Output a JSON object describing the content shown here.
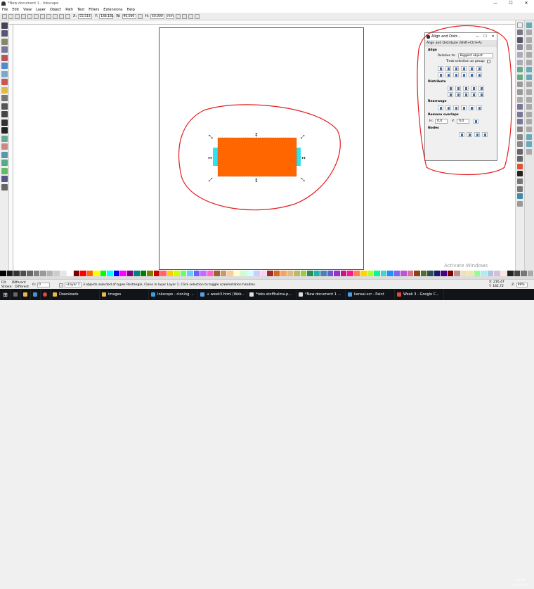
{
  "window": {
    "title": "*New document 1 - Inkscape",
    "controls": [
      "—",
      "☐",
      "✕"
    ]
  },
  "menu": [
    "File",
    "Edit",
    "View",
    "Layer",
    "Object",
    "Path",
    "Text",
    "Filters",
    "Extensions",
    "Help"
  ],
  "controls_bar": {
    "x_label": "X:",
    "x_value": "55,514",
    "y_label": "Y:",
    "y_value": "148,181",
    "w_label": "W:",
    "w_value": "90,000",
    "h_label": "H:",
    "h_value": "40,000",
    "unit": "mm"
  },
  "dialog": {
    "title": "Align and Distr...",
    "header": "Align and Distribute (Shift+Ctrl+A)",
    "controls": [
      "—",
      "☐",
      "✕"
    ],
    "align_label": "Align",
    "relative_label": "Relative to:",
    "relative_value": "Biggest object",
    "treat_label": "Treat selection as group:",
    "distribute_label": "Distribute",
    "rearrange_label": "Rearrange",
    "overlap_label": "Remove overlaps",
    "h_label": "H:",
    "h_value": "0,0",
    "v_label": "V:",
    "v_value": "0,0",
    "nodes_label": "Nodes"
  },
  "status": {
    "fill_label": "Fill:",
    "fill_value": "Different",
    "stroke_label": "Stroke:",
    "stroke_value": "Different",
    "o_label": "O:",
    "o_value": "0",
    "layer_value": "•Layer 1",
    "message": "3 objects selected of types Rectangle, Clone in layer Layer 1. Click selection to toggle scale/rotation handles.",
    "x_coord_label": "X:",
    "x_coord": "216,47",
    "y_coord_label": "Y:",
    "y_coord": "182,72",
    "z_label": "Z:",
    "zoom": "99%"
  },
  "watermark": "Activate Windows",
  "taskbar": {
    "items": [
      {
        "label": "Downloads",
        "color": "#e8b84a"
      },
      {
        "label": "images",
        "color": "#e8b84a"
      },
      {
        "label": "Inkscape - cloning ...",
        "color": "#3aa0e0"
      },
      {
        "label": "+ week3.html (Web...",
        "color": "#5aa0e0"
      },
      {
        "label": "*toks-stoffhalma.p...",
        "color": "#dddddd"
      },
      {
        "label": "*New document 1 ...",
        "color": "#dddddd"
      },
      {
        "label": "kansai-scr - Paint",
        "color": "#4aa0e0"
      },
      {
        "label": "Week 3 - Google C...",
        "color": "#e04a3a"
      }
    ],
    "time": "11:07",
    "date": "16.2.2016"
  },
  "colors": {
    "rect_fill": "#ff6600",
    "clone_fill": "#33e0ee",
    "annotation": "#e01f1f"
  }
}
